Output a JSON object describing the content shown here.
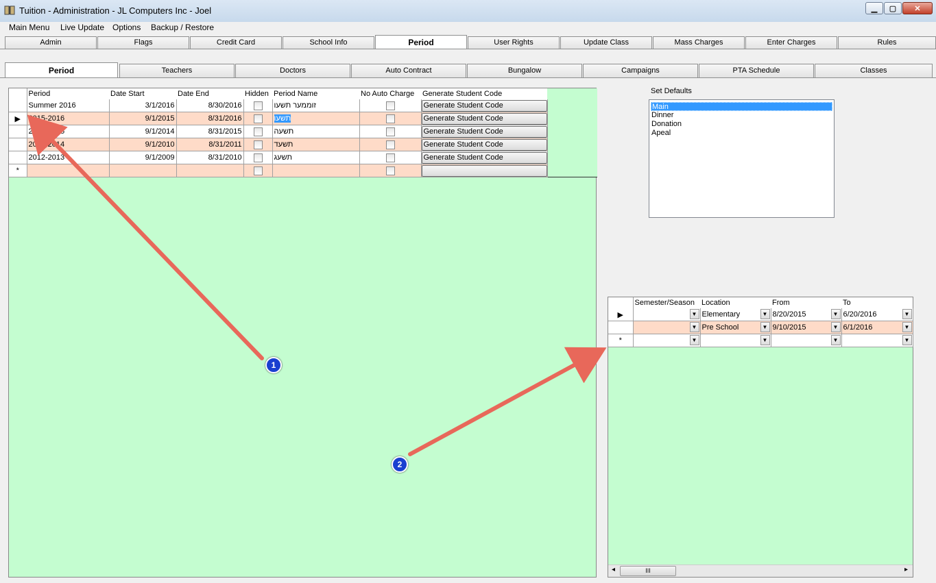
{
  "window": {
    "title": "Tuition - Administration - JL Computers Inc - Joel",
    "min_icon": "minimize-icon",
    "max_icon": "maximize-icon",
    "close_icon": "close-icon"
  },
  "menu": [
    "Main Menu",
    "Live Update",
    "Options",
    "Backup / Restore"
  ],
  "top_tabs": [
    "Admin",
    "Flags",
    "Credit Card",
    "School Info",
    "Period",
    "User Rights",
    "Update Class",
    "Mass Charges",
    "Enter Charges",
    "Rules"
  ],
  "top_tabs_selected": "Period",
  "sub_tabs": [
    "Period",
    "Teachers",
    "Doctors",
    "Auto Contract",
    "Bungalow",
    "Campaigns",
    "PTA Schedule",
    "Classes"
  ],
  "sub_tabs_selected": "Period",
  "period_grid": {
    "columns": [
      "Period",
      "Date Start",
      "Date End",
      "Hidden",
      "Period Name",
      "No Auto Charge",
      "Generate Student Code"
    ],
    "rows": [
      {
        "period": "Summer 2016",
        "start": "3/1/2016",
        "end": "8/30/2016",
        "name": "זוממער תשעו",
        "button": "Generate Student Code"
      },
      {
        "period": "2015-2016",
        "start": "9/1/2015",
        "end": "8/31/2016",
        "name": "תשעו",
        "button": "Generate Student Code"
      },
      {
        "period": "2014-2015",
        "start": "9/1/2014",
        "end": "8/31/2015",
        "name": "תשעה",
        "button": "Generate Student Code"
      },
      {
        "period": "2013-2014",
        "start": "9/1/2010",
        "end": "8/31/2011",
        "name": "תשעד",
        "button": "Generate Student Code"
      },
      {
        "period": "2012-2013",
        "start": "9/1/2009",
        "end": "8/31/2010",
        "name": "תשעג",
        "button": "Generate Student Code"
      }
    ],
    "new_row_marker": "*",
    "current_row_marker": "▶"
  },
  "set_defaults": {
    "label": "Set Defaults",
    "items": [
      "Main",
      "Dinner",
      "Donation",
      "Apeal"
    ],
    "selected": "Main"
  },
  "semester_grid": {
    "columns": [
      "Semester/Season",
      "Location",
      "From",
      "To"
    ],
    "rows": [
      {
        "semester": "",
        "location": "Elementary",
        "from": "8/20/2015",
        "to": "6/20/2016"
      },
      {
        "semester": "",
        "location": "Pre School",
        "from": "9/10/2015",
        "to": "6/1/2016"
      }
    ],
    "new_row_marker": "*",
    "current_row_marker": "▶"
  },
  "annotations": [
    {
      "label": "1",
      "color": "#e8685a"
    },
    {
      "label": "2",
      "color": "#e8685a"
    }
  ],
  "scrollbar": {
    "left_arrow": "◂",
    "thumb": "III",
    "right_arrow": "▸"
  }
}
